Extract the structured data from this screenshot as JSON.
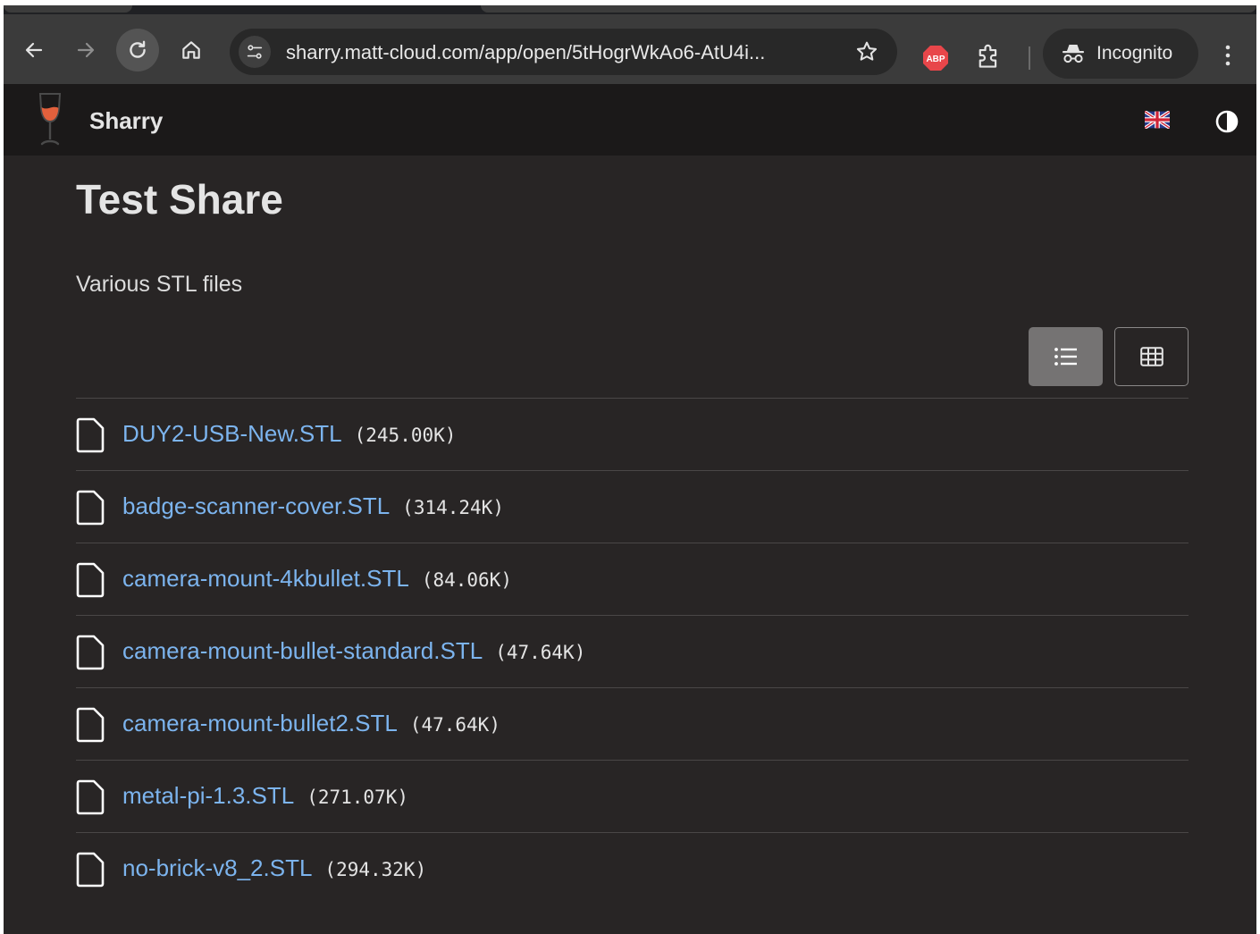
{
  "browser": {
    "url": "sharry.matt-cloud.com/app/open/5tHogrWkAo6-AtU4i...",
    "incognito_label": "Incognito",
    "extension_abp_label": "ABP"
  },
  "header": {
    "app_name": "Sharry"
  },
  "share": {
    "title": "Test Share",
    "description": "Various STL files"
  },
  "files": [
    {
      "name": "DUY2-USB-New.STL",
      "size": "(245.00K)"
    },
    {
      "name": "badge-scanner-cover.STL",
      "size": "(314.24K)"
    },
    {
      "name": "camera-mount-4kbullet.STL",
      "size": "(84.06K)"
    },
    {
      "name": "camera-mount-bullet-standard.STL",
      "size": "(47.64K)"
    },
    {
      "name": "camera-mount-bullet2.STL",
      "size": "(47.64K)"
    },
    {
      "name": "metal-pi-1.3.STL",
      "size": "(271.07K)"
    },
    {
      "name": "no-brick-v8_2.STL",
      "size": "(294.32K)"
    }
  ],
  "view_mode": "list",
  "colors": {
    "link": "#7cb4ee",
    "background": "#282525",
    "header_background": "#1b1919",
    "active_view_button": "#757373"
  },
  "icons": {
    "back": "arrow-left-icon",
    "forward": "arrow-right-icon",
    "reload": "reload-icon",
    "home": "home-icon",
    "site_info": "tune-icon",
    "bookmark": "star-icon",
    "extensions": "puzzle-icon",
    "incognito": "incognito-icon",
    "menu": "kebab-menu-icon",
    "logo": "wine-glass-icon",
    "language": "uk-flag-icon",
    "theme": "half-circle-icon",
    "list_view": "list-icon",
    "grid_view": "grid-icon",
    "file": "file-icon"
  }
}
